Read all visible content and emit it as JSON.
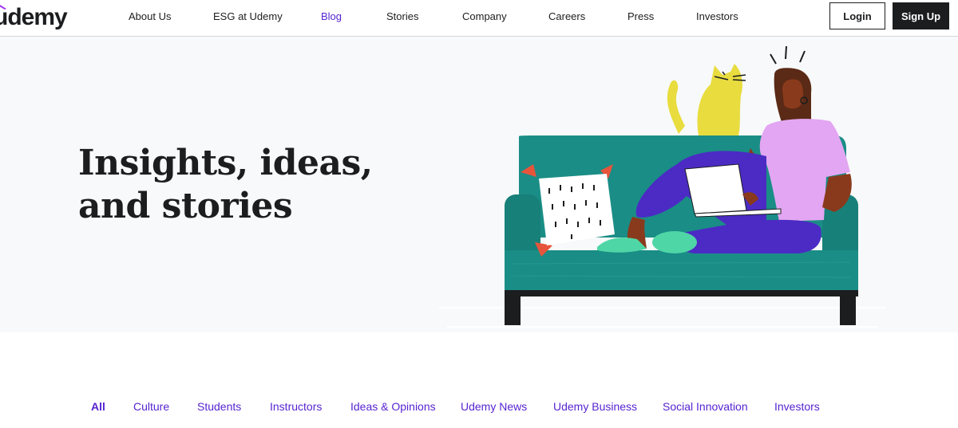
{
  "brand": {
    "name": "udemy",
    "accent": "#a435f0"
  },
  "nav": {
    "items": [
      {
        "label": "About Us",
        "active": false
      },
      {
        "label": "ESG at Udemy",
        "active": false
      },
      {
        "label": "Blog",
        "active": true
      },
      {
        "label": "Stories",
        "active": false
      },
      {
        "label": "Company",
        "active": false
      },
      {
        "label": "Careers",
        "active": false
      },
      {
        "label": "Press",
        "active": false
      },
      {
        "label": "Investors",
        "active": false
      }
    ],
    "login_label": "Login",
    "signup_label": "Sign Up"
  },
  "hero": {
    "title": "Insights, ideas, and stories"
  },
  "categories": {
    "items": [
      {
        "label": "All",
        "active": true
      },
      {
        "label": "Culture",
        "active": false
      },
      {
        "label": "Students",
        "active": false
      },
      {
        "label": "Instructors",
        "active": false
      },
      {
        "label": "Ideas & Opinions",
        "active": false
      },
      {
        "label": "Udemy News",
        "active": false
      },
      {
        "label": "Udemy Business",
        "active": false
      },
      {
        "label": "Social Innovation",
        "active": false
      },
      {
        "label": "Investors",
        "active": false
      }
    ]
  },
  "colors": {
    "link": "#5624d0",
    "sofa": "#1a8d86",
    "cat": "#e8dc3f",
    "shirt": "#e3a6f2",
    "pants": "#4b2bc4",
    "skin": "#8a3a1c",
    "pillow_corner": "#e6553b",
    "slipper": "#4fd6a6"
  }
}
